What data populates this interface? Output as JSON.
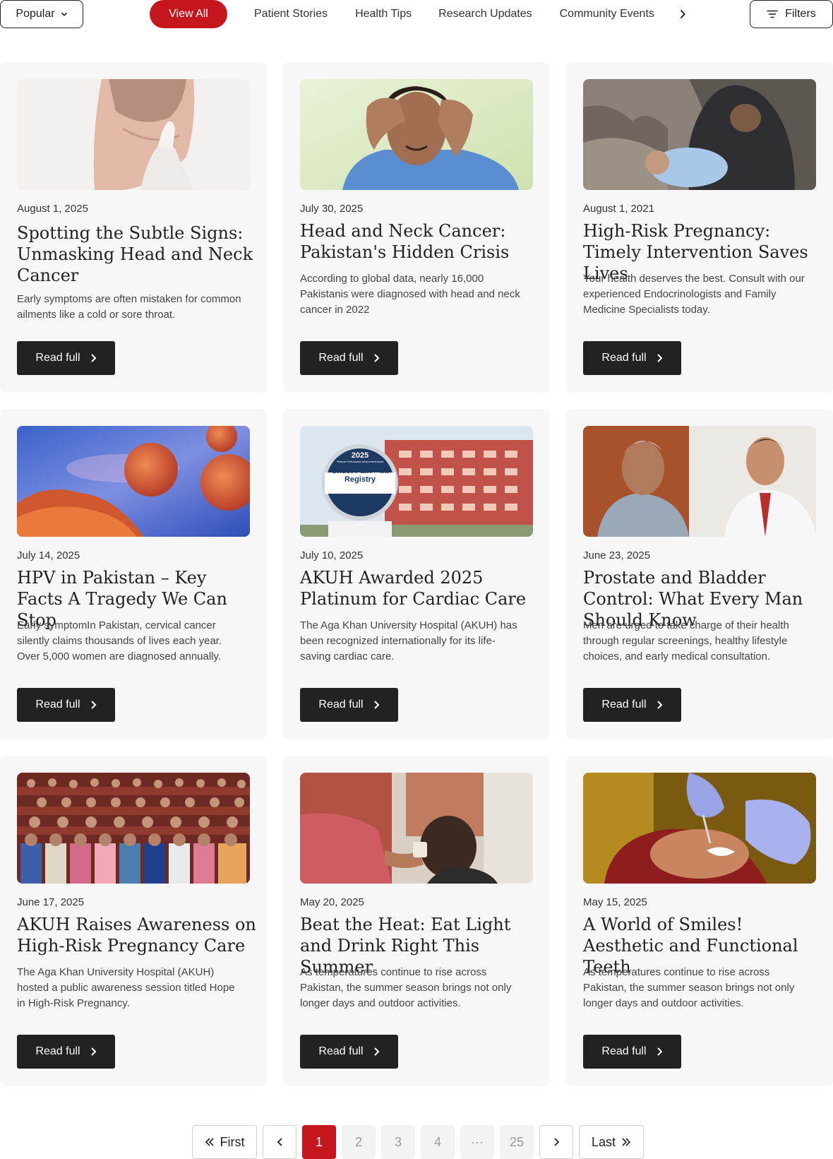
{
  "toolbar": {
    "sort_label": "Popular",
    "filters_label": "Filters"
  },
  "tabs": [
    {
      "label": "View All",
      "active": true
    },
    {
      "label": "Patient Stories"
    },
    {
      "label": "Health Tips"
    },
    {
      "label": "Research Updates"
    },
    {
      "label": "Community Events"
    }
  ],
  "colors": {
    "accent": "#c4161c",
    "button_dark": "#222222",
    "card_bg": "#f7f7f7"
  },
  "cards": [
    {
      "date": "August 1, 2025",
      "title": "Spotting the Subtle Signs: Unmasking Head and Neck Cancer",
      "desc": "Early symptoms are often mistaken for common ailments like a cold or sore throat.",
      "button": "Read full",
      "image": "neck-exam-photo"
    },
    {
      "date": "July 30, 2025",
      "title": "Head and Neck Cancer: Pakistan's Hidden Crisis",
      "desc": "According to global data, nearly 16,000 Pakistanis were diagnosed with head and neck cancer in 2022",
      "button": "Read full",
      "image": "worried-man-photo"
    },
    {
      "date": "August 1, 2021",
      "title": "High-Risk Pregnancy: Timely Intervention Saves Lives",
      "desc": "Your health deserves the best. Consult with our experienced Endocrinologists and Family Medicine Specialists today.",
      "button": "Read full",
      "image": "mother-baby-photo"
    },
    {
      "date": "July 14, 2025",
      "title": "HPV in Pakistan – Key Facts A Tragedy We Can Stop",
      "desc": "Early symptomIn Pakistan, cervical cancer silently claims thousands of lives each year. Over 5,000 women are diagnosed annually.",
      "button": "Read full",
      "image": "hpv-virus-illustration"
    },
    {
      "date": "July 10, 2025",
      "title": "AKUH Awarded 2025 Platinum for Cardiac Care",
      "desc": "The Aga Khan University Hospital (AKUH) has been recognized internationally for its life-saving cardiac care.",
      "button": "Read full",
      "image": "hospital-award-photo",
      "badge": {
        "year": "2025",
        "subtitle": "Platinum Performance Achievement Award",
        "line1": "Chest Pain – MI",
        "line2": "Registry",
        "org": "NCDR"
      }
    },
    {
      "date": "June 23, 2025",
      "title": "Prostate and Bladder Control: What Every Man Should Know",
      "desc": "Men are urged to take charge of their health through regular screenings, healthy lifestyle choices, and early medical consultation.",
      "button": "Read full",
      "image": "doctor-patient-photo"
    },
    {
      "date": "June 17, 2025",
      "title": "AKUH Raises Awareness on High-Risk Pregnancy Care",
      "desc": "The Aga Khan University Hospital (AKUH) hosted a public awareness session titled Hope in High-Risk Pregnancy.",
      "button": "Read full",
      "image": "audience-group-photo"
    },
    {
      "date": "May 20, 2025",
      "title": "Beat the Heat: Eat Light and Drink Right This Summer",
      "desc": "As temperatures continue to rise across Pakistan, the summer season brings not only longer days and outdoor activities.",
      "button": "Read full",
      "image": "child-drinking-photo"
    },
    {
      "date": "May 15, 2025",
      "title": "A World of Smiles! Aesthetic and Functional Teeth",
      "desc": "As temperatures continue to rise across Pakistan, the summer season brings not only longer days and outdoor activities.",
      "button": "Read full",
      "image": "dental-exam-photo"
    }
  ],
  "pagination": {
    "first": "First",
    "last": "Last",
    "current": "1",
    "pages": [
      "2",
      "3",
      "4"
    ],
    "ellipsis": "···",
    "final": "25"
  }
}
